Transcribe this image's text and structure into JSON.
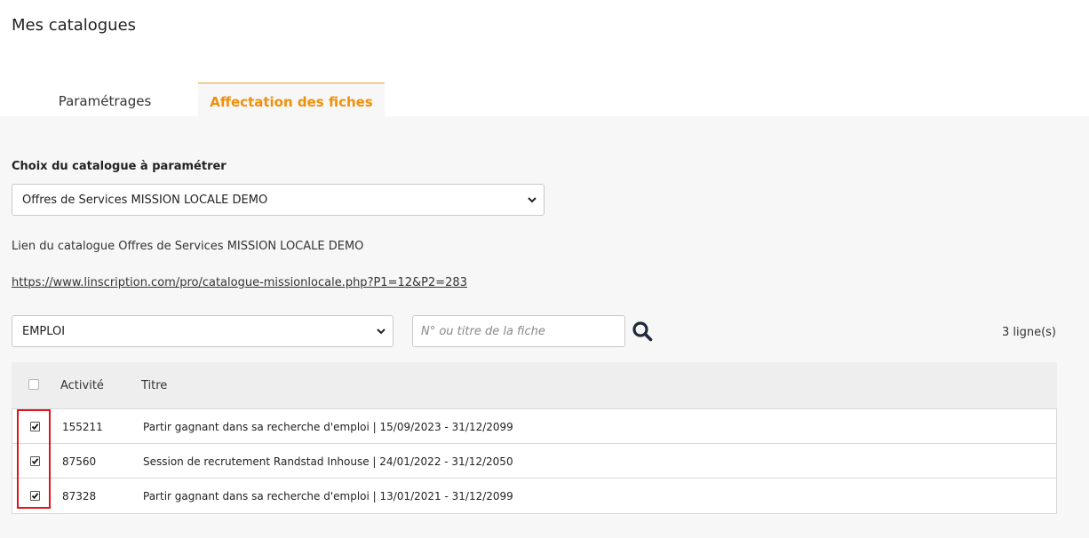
{
  "page": {
    "title": "Mes catalogues"
  },
  "tabs": [
    {
      "label": "Paramétrages",
      "active": false
    },
    {
      "label": "Affectation des fiches",
      "active": true
    }
  ],
  "catalogue": {
    "label": "Choix du catalogue à paramétrer",
    "selected": "Offres de Services MISSION LOCALE DEMO",
    "link_caption": "Lien du catalogue Offres de Services MISSION LOCALE DEMO",
    "url": "https://www.linscription.com/pro/catalogue-missionlocale.php?P1=12&P2=283"
  },
  "filter": {
    "category": "EMPLOI",
    "search_placeholder": "N° ou titre de la fiche",
    "row_count": "3 ligne(s)"
  },
  "table": {
    "columns": [
      "Activité",
      "Titre"
    ],
    "rows": [
      {
        "activite": "155211",
        "titre": "Partir gagnant dans sa recherche d'emploi | 15/09/2023 - 31/12/2099",
        "checked": true
      },
      {
        "activite": "87560",
        "titre": "Session de recrutement Randstad Inhouse | 24/01/2022 - 31/12/2050",
        "checked": true
      },
      {
        "activite": "87328",
        "titre": "Partir gagnant dans sa recherche d'emploi | 13/01/2021 - 31/12/2099",
        "checked": true
      }
    ]
  },
  "colors": {
    "accent": "#f0900a",
    "highlight": "#e0141c",
    "panel_bg": "#f7f7f7"
  }
}
